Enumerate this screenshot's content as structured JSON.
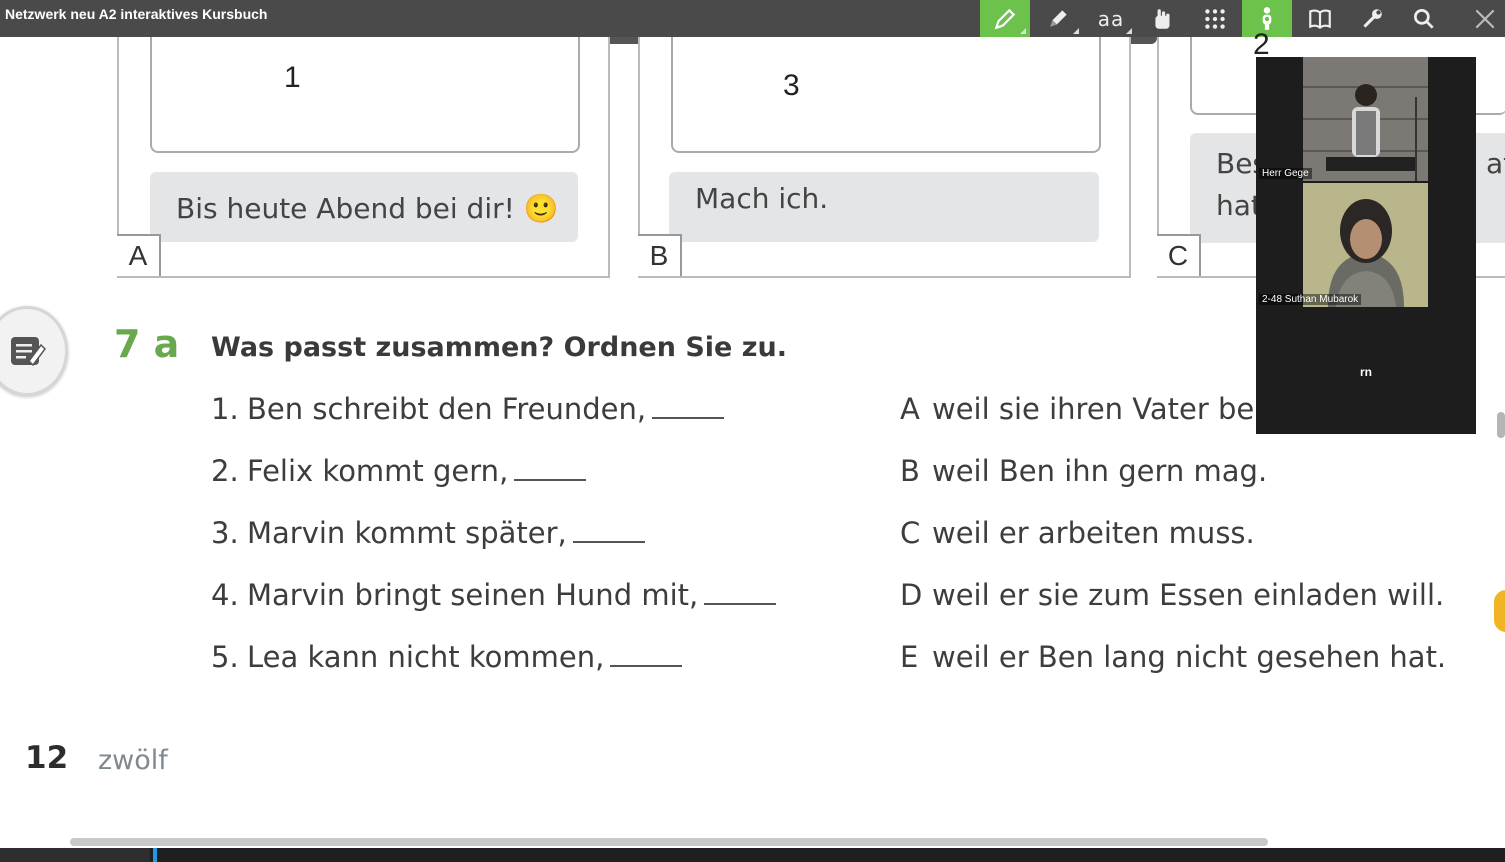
{
  "app": {
    "title": "Netzwerk neu A2 interaktives Kursbuch"
  },
  "toolbar": {
    "text_size_label": "aa",
    "tools": [
      {
        "name": "marker",
        "icon": "highlighter-icon",
        "active": true
      },
      {
        "name": "pen",
        "icon": "pen-icon",
        "active": false
      },
      {
        "name": "text",
        "icon": "text-size-icon",
        "active": false
      },
      {
        "name": "select",
        "icon": "hand-pointer-icon",
        "active": false
      },
      {
        "name": "apps",
        "icon": "grid-icon",
        "active": false
      },
      {
        "name": "presenter",
        "icon": "person-icon",
        "active": true
      },
      {
        "name": "book",
        "icon": "book-icon",
        "active": false
      },
      {
        "name": "settings",
        "icon": "wrench-icon",
        "active": false
      },
      {
        "name": "search",
        "icon": "search-icon",
        "active": false
      },
      {
        "name": "close",
        "icon": "close-icon",
        "active": false
      }
    ]
  },
  "panels": [
    {
      "label": "A",
      "bubble_number": "1",
      "message": "Bis heute Abend bei dir!",
      "emoji": "🙂"
    },
    {
      "label": "B",
      "bubble_number": "3",
      "message": "Mach ich."
    },
    {
      "label": "C",
      "bubble_number": "2",
      "message_line1": "Bes",
      "message_line2": "hat",
      "overflow_text": "ate"
    }
  ],
  "video": {
    "participants": [
      {
        "name": "Herr Gege"
      },
      {
        "name": "2-48 Suthan Mubarok"
      },
      {
        "name": "rn"
      }
    ]
  },
  "exercise": {
    "number": "7 a",
    "instruction": "Was passt zusammen? Ordnen Sie zu.",
    "sentences": [
      {
        "num": "1.",
        "text": "Ben schreibt den Freunden,"
      },
      {
        "num": "2.",
        "text": "Felix kommt gern,"
      },
      {
        "num": "3.",
        "text": "Marvin kommt später,"
      },
      {
        "num": "4.",
        "text": "Marvin bringt seinen Hund mit,"
      },
      {
        "num": "5.",
        "text": "Lea kann nicht kommen,"
      }
    ],
    "options": [
      {
        "letter": "A",
        "text": "weil sie ihren Vater bes"
      },
      {
        "letter": "B",
        "text": "weil Ben ihn gern mag."
      },
      {
        "letter": "C",
        "text": "weil er arbeiten muss."
      },
      {
        "letter": "D",
        "text": "weil er sie zum Essen einladen will."
      },
      {
        "letter": "E",
        "text": "weil er Ben lang nicht gesehen hat."
      }
    ]
  },
  "page": {
    "number": "12",
    "word": "zwölf"
  },
  "colors": {
    "accent_green": "#6cc24a",
    "exercise_green": "#6aa84f",
    "toolbar_bg": "#4a4a4a",
    "handle_orange": "#f1b424"
  }
}
